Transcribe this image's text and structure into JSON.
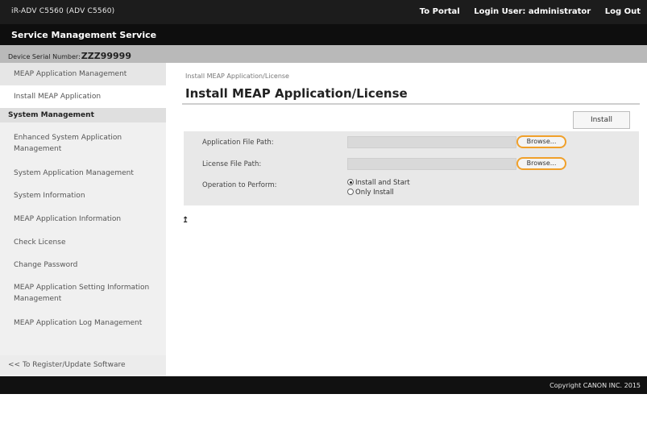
{
  "header": {
    "product_line": "iR-ADV C5560 (ADV C5560)",
    "portal_link": "To Portal",
    "login_user_label": "Login User: administrator",
    "logout_link": "Log Out"
  },
  "service_bar": {
    "title": "Service Management Service"
  },
  "serial": {
    "label": "Device Serial Number:",
    "value": "ZZZ99999"
  },
  "sidebar": {
    "top_items": [
      "MEAP Application Management",
      "Install MEAP Application"
    ],
    "section_title": "System Management",
    "items": [
      "Enhanced System Application Management",
      "System Application Management",
      "System Information",
      "MEAP Application Information",
      "Check License",
      "Change Password",
      "MEAP Application Setting Information Management",
      "MEAP Application Log Management"
    ],
    "bottom_link": "<< To Register/Update Software"
  },
  "main": {
    "breadcrumb": "Install MEAP Application/License",
    "title": "Install MEAP Application/License",
    "install_button": "Install",
    "form": {
      "app_file_label": "Application File Path:",
      "license_file_label": "License File Path:",
      "operation_label": "Operation to Perform:",
      "browse_label": "Browse...",
      "options": [
        "Install and Start",
        "Only Install"
      ],
      "selected_option": "Install and Start"
    },
    "top_arrow": "↥"
  },
  "footer": {
    "copyright": "Copyright CANON INC. 2015"
  },
  "colors": {
    "browse_highlight": "#f0a02a",
    "header_bg": "#1c1c1c",
    "footer_bg": "#111111"
  }
}
